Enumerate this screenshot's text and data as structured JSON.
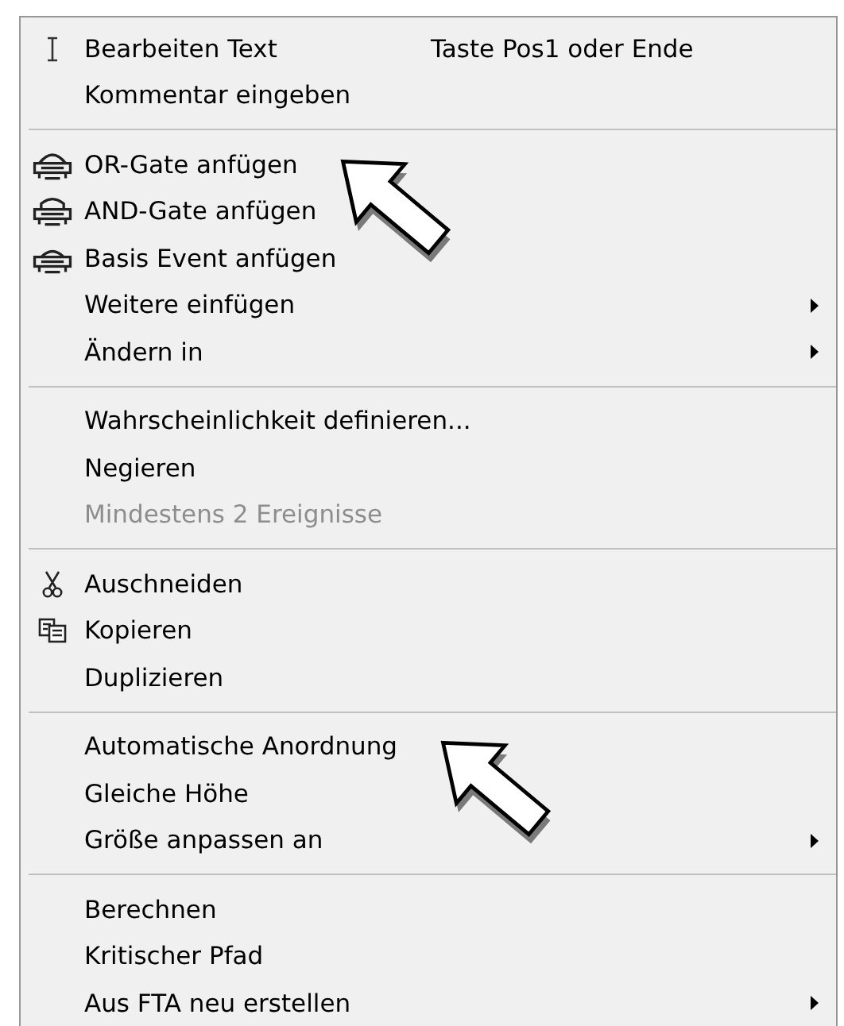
{
  "menu": {
    "sections": [
      {
        "items": [
          {
            "label": "Bearbeiten Text",
            "kind": "text-cursor",
            "shortcut": "Taste Pos1 oder Ende",
            "submenu": false,
            "disabled": false,
            "annotated": false
          },
          {
            "label": "Kommentar eingeben",
            "submenu": false,
            "disabled": false,
            "annotated": false
          }
        ]
      },
      {
        "items": [
          {
            "label": "OR-Gate anfügen",
            "kind": "or-gate",
            "submenu": false,
            "disabled": false,
            "annotated": true
          },
          {
            "label": "AND-Gate anfügen",
            "kind": "and-gate",
            "submenu": false,
            "disabled": false,
            "annotated": false
          },
          {
            "label": "Basis Event anfügen",
            "kind": "basic-event",
            "submenu": false,
            "disabled": false,
            "annotated": false
          },
          {
            "label": "Weitere einfügen",
            "submenu": true,
            "disabled": false,
            "annotated": false
          },
          {
            "label": "Ändern in",
            "submenu": true,
            "disabled": false,
            "annotated": false
          }
        ]
      },
      {
        "items": [
          {
            "label": "Wahrscheinlichkeit definieren...",
            "submenu": false,
            "disabled": false,
            "annotated": false
          },
          {
            "label": "Negieren",
            "submenu": false,
            "disabled": false,
            "annotated": false
          },
          {
            "label": "Mindestens 2 Ereignisse",
            "submenu": false,
            "disabled": true,
            "annotated": false
          }
        ]
      },
      {
        "items": [
          {
            "label": "Auschneiden",
            "kind": "scissors",
            "submenu": false,
            "disabled": false,
            "annotated": false
          },
          {
            "label": "Kopieren",
            "kind": "copy",
            "submenu": false,
            "disabled": false,
            "annotated": false
          },
          {
            "label": "Duplizieren",
            "submenu": false,
            "disabled": false,
            "annotated": false
          }
        ]
      },
      {
        "items": [
          {
            "label": "Automatische Anordnung",
            "submenu": false,
            "disabled": false,
            "annotated": true
          },
          {
            "label": "Gleiche Höhe",
            "submenu": false,
            "disabled": false,
            "annotated": false
          },
          {
            "label": "Größe anpassen an",
            "submenu": true,
            "disabled": false,
            "annotated": false
          }
        ]
      },
      {
        "items": [
          {
            "label": "Berechnen",
            "submenu": false,
            "disabled": false,
            "annotated": false
          },
          {
            "label": "Kritischer Pfad",
            "submenu": false,
            "disabled": false,
            "annotated": false
          },
          {
            "label": "Aus FTA neu erstellen",
            "submenu": true,
            "disabled": false,
            "annotated": false
          }
        ]
      }
    ]
  }
}
